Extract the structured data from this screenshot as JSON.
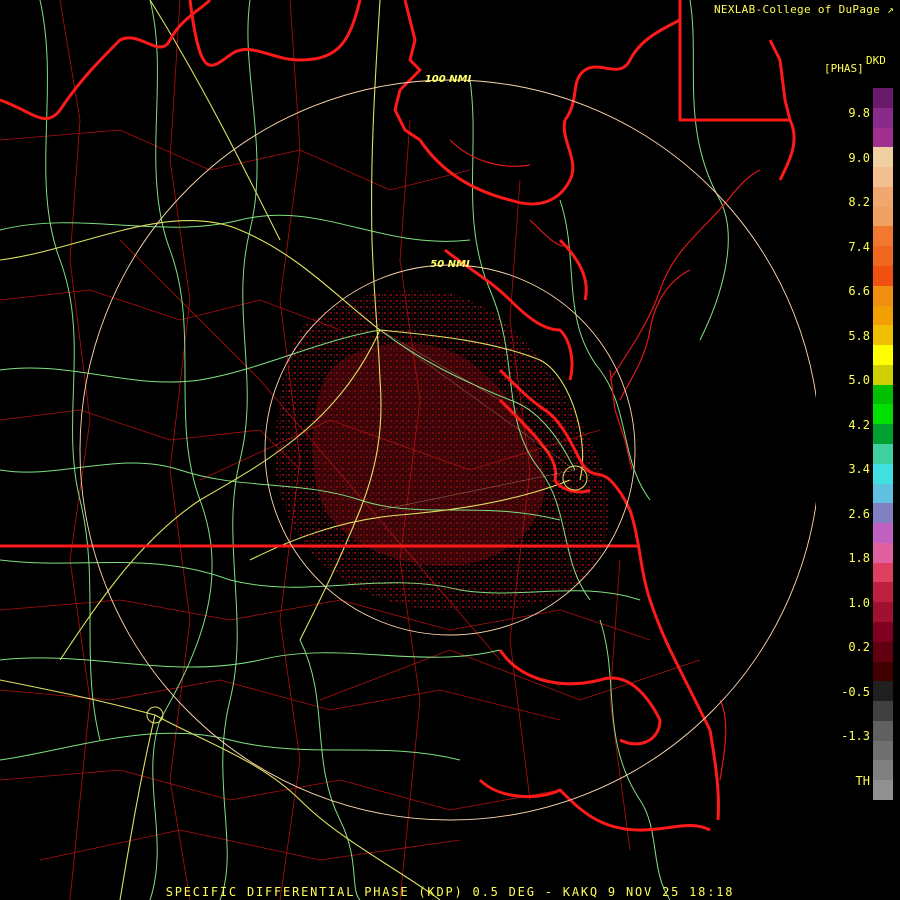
{
  "credit": "NEXLAB-College of DuPage",
  "units_label": "[PHAS]",
  "product_code": "DKD",
  "footer": "SPECIFIC DIFFERENTIAL PHASE (KDP) 0.5 DEG - KAKQ 9 NOV 25 18:18",
  "range_rings": [
    {
      "label": "50 NMI"
    },
    {
      "label": "100 NMI"
    }
  ],
  "scale_ticks": [
    "9.8",
    "9.0",
    "8.2",
    "7.4",
    "6.6",
    "5.8",
    "5.0",
    "4.2",
    "3.4",
    "2.6",
    "1.8",
    "1.0",
    "0.2",
    "-0.5",
    "-1.3",
    "TH"
  ],
  "scale_colors": [
    "#6a1a6a",
    "#8a2a8a",
    "#a03090",
    "#f0d0a0",
    "#f5c090",
    "#f0a870",
    "#f0a060",
    "#f07830",
    "#f06820",
    "#f05010",
    "#f09010",
    "#f0a000",
    "#f0c000",
    "#ffff00",
    "#d0d000",
    "#00c000",
    "#00e000",
    "#00a030",
    "#40d0a0",
    "#40e0e0",
    "#60c0e0",
    "#8080c0",
    "#c060c0",
    "#e060a0",
    "#e04060",
    "#c02040",
    "#a01030",
    "#800020",
    "#600010",
    "#400000",
    "#202020",
    "#404040",
    "#606060",
    "#707070",
    "#808080",
    "#909090"
  ],
  "colors": {
    "state_border": "#ff1a1a",
    "county_line": "#b01010",
    "highway": "#80e080",
    "interstate": "#e0e060",
    "range_ring": "#ffd8b0",
    "echo": "#7a0a10"
  }
}
